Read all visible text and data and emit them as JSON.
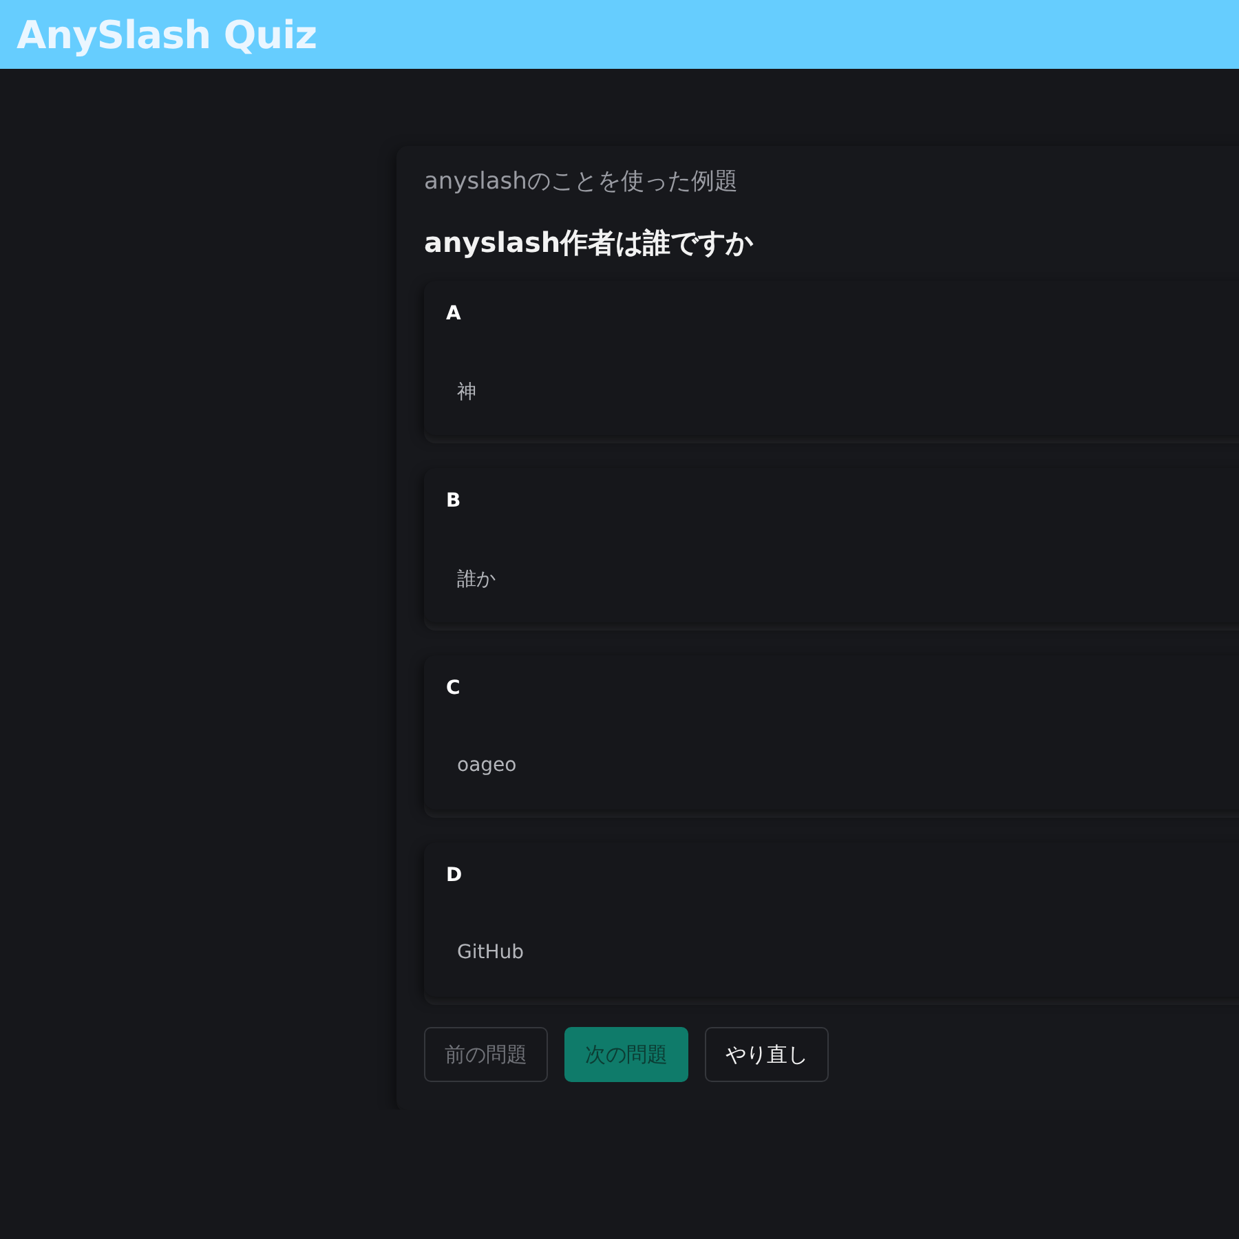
{
  "header": {
    "title": "AnySlash Quiz"
  },
  "quiz": {
    "category": "anyslashのことを使った例題",
    "question": "anyslash作者は誰ですか",
    "options": [
      {
        "letter": "A",
        "text": "神"
      },
      {
        "letter": "B",
        "text": "誰か"
      },
      {
        "letter": "C",
        "text": "oageo"
      },
      {
        "letter": "D",
        "text": "GitHub"
      }
    ],
    "buttons": [
      {
        "label": "前の問題",
        "kind": "default",
        "disabled": true
      },
      {
        "label": "次の問題",
        "kind": "primary",
        "disabled": true
      },
      {
        "label": "やり直し",
        "kind": "default",
        "disabled": false
      }
    ]
  }
}
